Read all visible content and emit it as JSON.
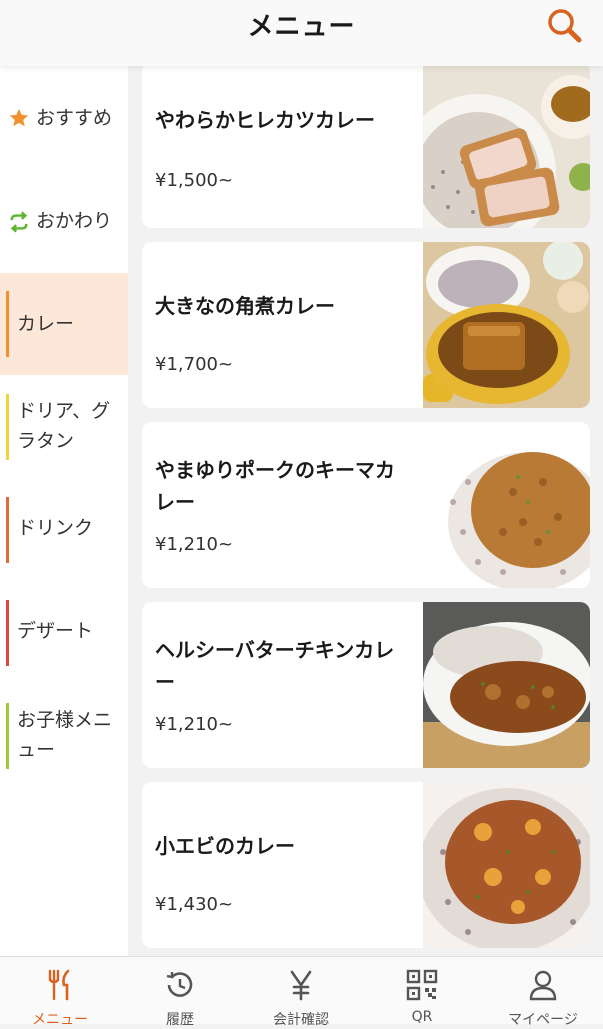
{
  "header": {
    "title": "メニュー",
    "search_icon": "search-icon"
  },
  "sidebar": {
    "items": [
      {
        "label": "おすすめ",
        "icon": "star-icon"
      },
      {
        "label": "おかわり",
        "icon": "refresh-icon"
      },
      {
        "label": "カレー",
        "active": true
      },
      {
        "label": "ドリア、グラタン"
      },
      {
        "label": "ドリンク"
      },
      {
        "label": "デザート"
      },
      {
        "label": "お子様メニュー"
      }
    ]
  },
  "menu": {
    "items": [
      {
        "name": "やわらかヒレカツカレー",
        "price": "¥1,500~"
      },
      {
        "name": "大きなの角煮カレー",
        "price": "¥1,700~"
      },
      {
        "name": "やまゆりポークのキーマカレー",
        "price": "¥1,210~"
      },
      {
        "name": "ヘルシーバターチキンカレー",
        "price": "¥1,210~"
      },
      {
        "name": "小エビのカレー",
        "price": "¥1,430~"
      }
    ]
  },
  "tabbar": {
    "tabs": [
      {
        "label": "メニュー",
        "icon": "fork-knife-icon",
        "active": true
      },
      {
        "label": "履歴",
        "icon": "history-icon"
      },
      {
        "label": "会計確認",
        "icon": "yen-icon"
      },
      {
        "label": "QR",
        "icon": "qr-code-icon"
      },
      {
        "label": "マイページ",
        "icon": "user-icon"
      }
    ]
  },
  "colors": {
    "accent": "#d9621f",
    "active_bg": "#fde7d8",
    "star": "#f0912e",
    "refresh": "#5cb531"
  }
}
